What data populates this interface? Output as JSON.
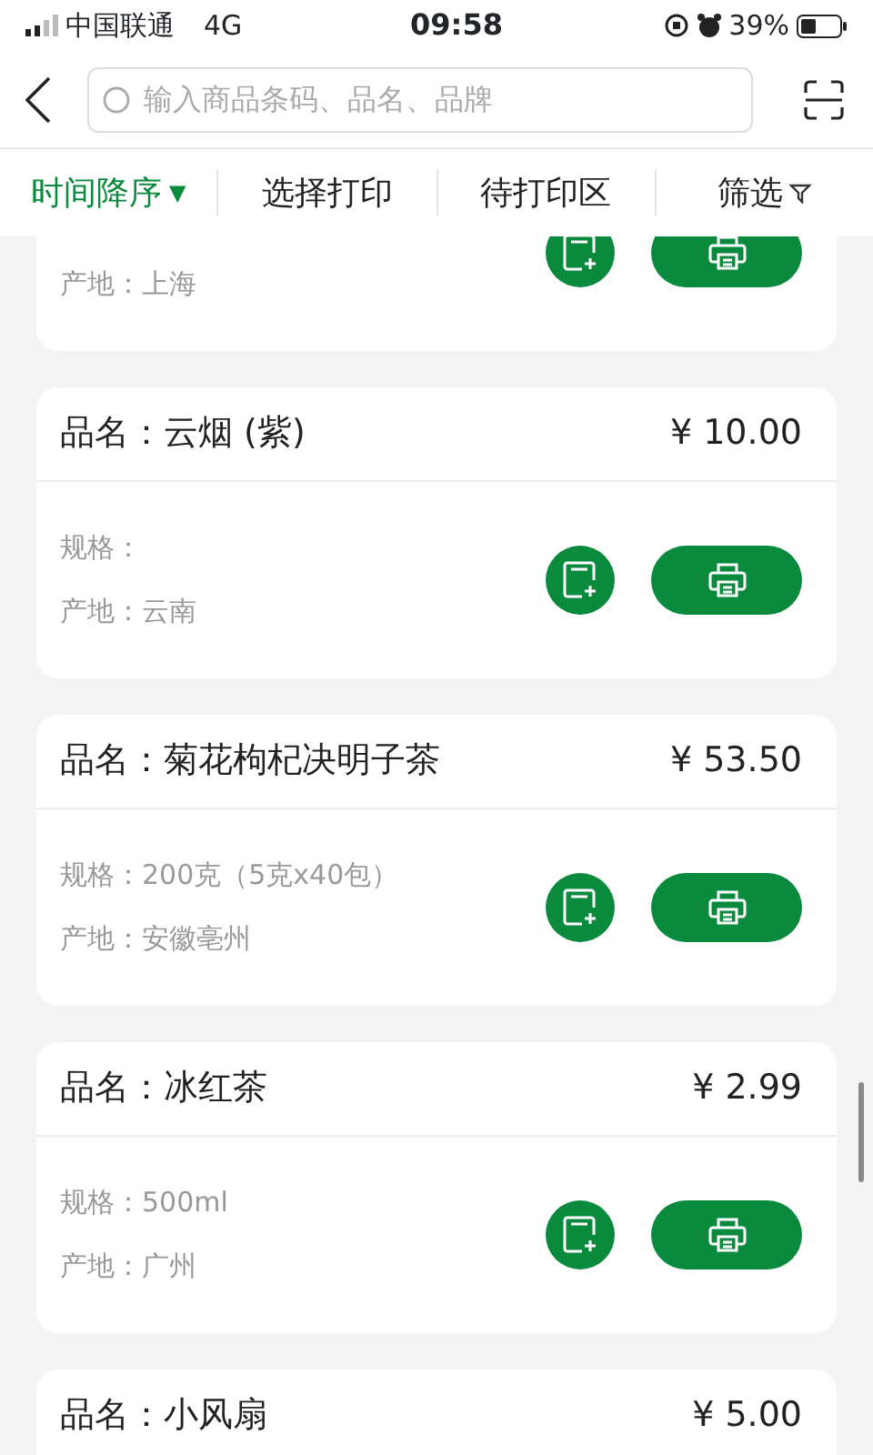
{
  "status_bar": {
    "carrier": "中国联通",
    "network": "4G",
    "time": "09:58",
    "battery": "39%"
  },
  "search": {
    "placeholder": "输入商品条码、品名、品牌"
  },
  "tabs": [
    {
      "label": "时间降序",
      "caret": "▼",
      "selected": true,
      "kind": "sort"
    },
    {
      "label": "选择打印",
      "selected": false,
      "kind": "plain"
    },
    {
      "label": "待打印区",
      "selected": false,
      "kind": "plain"
    },
    {
      "label": "筛选",
      "selected": false,
      "kind": "filter"
    }
  ],
  "products": [
    {
      "origin": "产地：上海"
    },
    {
      "name": "品名：云烟 (紫)",
      "price": "¥ 10.00",
      "spec": "规格：",
      "origin": "产地：云南"
    },
    {
      "name": "品名：菊花枸杞决明子茶",
      "price": "¥ 53.50",
      "spec": "规格：200克（5克x40包）",
      "origin": "产地：安徽亳州"
    },
    {
      "name": "品名：冰红茶",
      "price": "¥ 2.99",
      "spec": "规格：500ml",
      "origin": "产地：广州"
    },
    {
      "name": "品名：小风扇",
      "price": "¥ 5.00"
    }
  ]
}
